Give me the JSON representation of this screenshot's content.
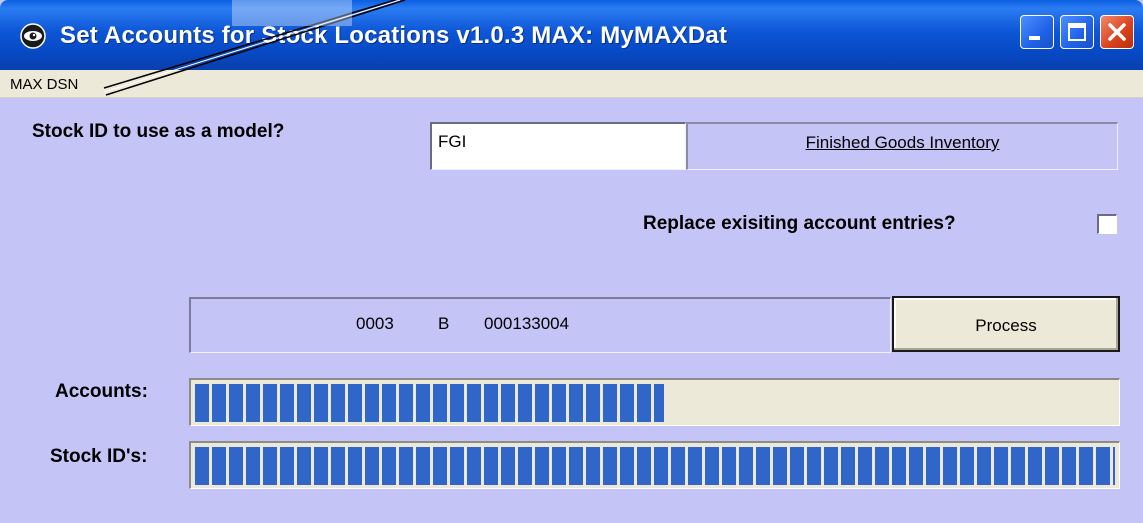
{
  "window": {
    "title": "Set Accounts for Stock Locations v1.0.3 MAX: MyMAXDat",
    "icon": "eye-logo-icon",
    "controls": [
      "minimize-icon",
      "maximize-icon",
      "close-icon"
    ]
  },
  "menu": {
    "items": [
      {
        "label": "MAX DSN"
      }
    ]
  },
  "form": {
    "stock_label": "Stock ID to use as a model?",
    "stock_value": "FGI",
    "stock_description": "Finished Goods Inventory",
    "replace_label": "Replace exisiting account entries?",
    "replace_checked": false
  },
  "status": {
    "field1": "0003",
    "field2": "B",
    "field3": "000133004"
  },
  "buttons": {
    "process": "Process"
  },
  "progress": {
    "accounts_label": "Accounts:",
    "accounts_fraction": 0.51,
    "stockids_label": "Stock ID's:",
    "stockids_fraction": 1.0
  },
  "colors": {
    "titlebar": "#0a50d8",
    "client_bg": "#c4c4f6",
    "progress_fill": "#2f66c8"
  }
}
